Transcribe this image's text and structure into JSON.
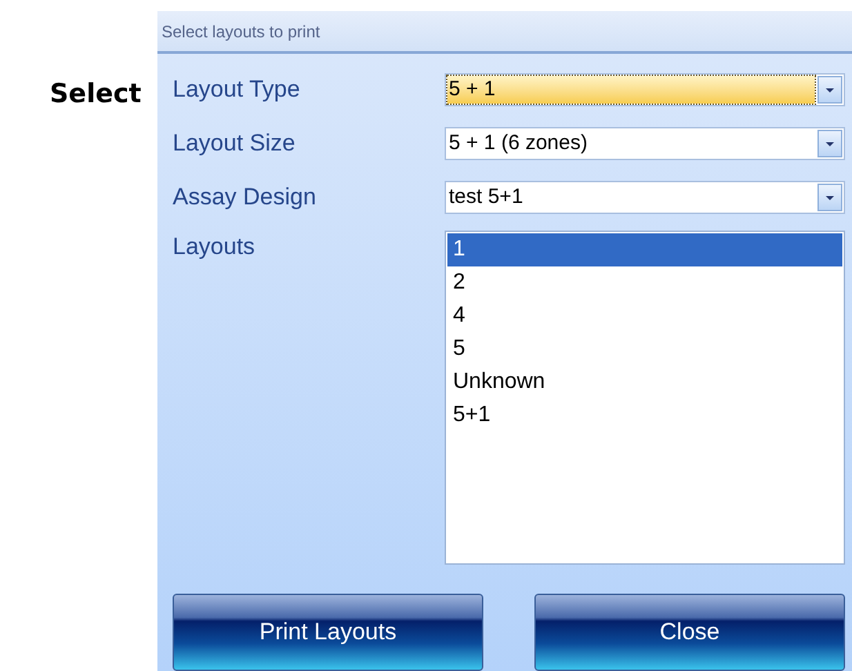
{
  "side_heading": "Select",
  "dialog": {
    "title": "Select layouts to print",
    "fields": [
      {
        "label": "Layout Type",
        "value": "5 + 1",
        "focused": true
      },
      {
        "label": "Layout Size",
        "value": "5 + 1 (6 zones)",
        "focused": false
      },
      {
        "label": "Assay Design",
        "value": "test 5+1",
        "focused": false
      }
    ],
    "layouts": {
      "label": "Layouts",
      "items": [
        {
          "text": "1",
          "selected": true
        },
        {
          "text": "2",
          "selected": false
        },
        {
          "text": "4",
          "selected": false
        },
        {
          "text": "5",
          "selected": false
        },
        {
          "text": "Unknown",
          "selected": false
        },
        {
          "text": "5+1",
          "selected": false
        }
      ]
    },
    "buttons": [
      "Print Layouts",
      "Close"
    ]
  }
}
